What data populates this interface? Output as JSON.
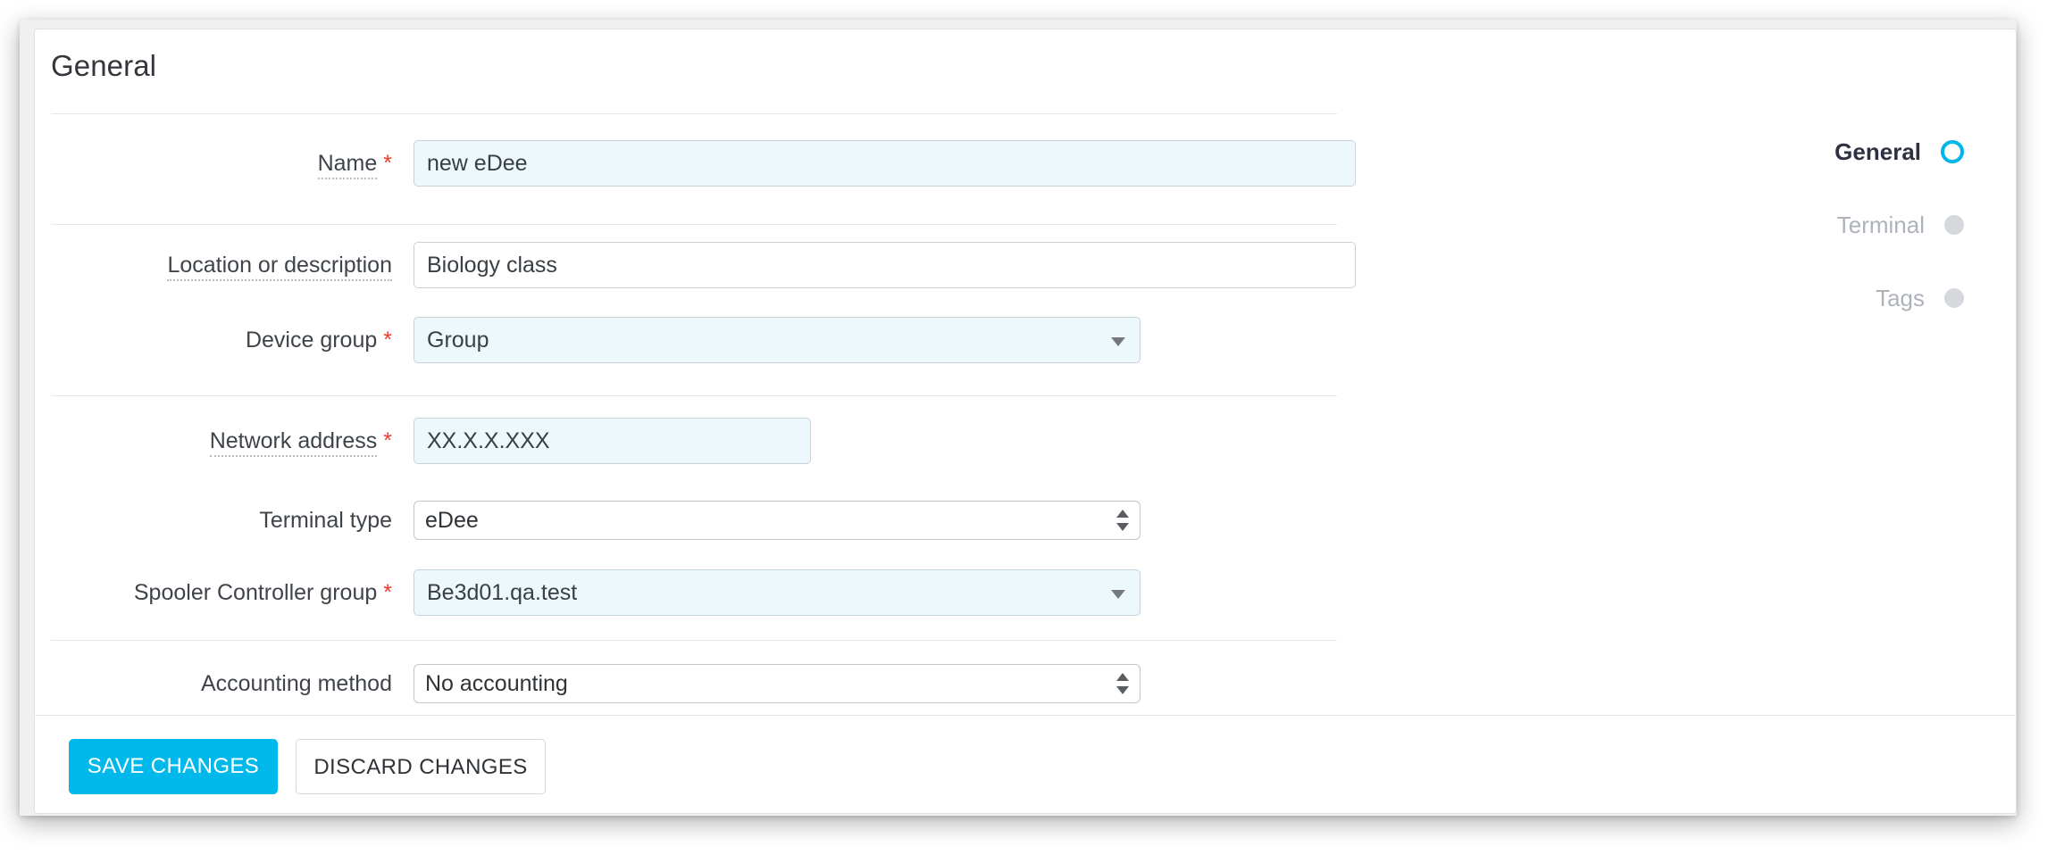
{
  "card": {
    "title": "General"
  },
  "form": {
    "rows": [
      {
        "id": "name",
        "label": "Name",
        "required": true,
        "tooltip_underline": true,
        "control": "text",
        "value": "new eDee",
        "highlight": true
      },
      {
        "id": "location",
        "label": "Location or description",
        "required": false,
        "tooltip_underline": true,
        "control": "text",
        "value": "Biology class",
        "highlight": false
      },
      {
        "id": "device-group",
        "label": "Device group",
        "required": true,
        "tooltip_underline": false,
        "control": "dropdown",
        "value": "Group",
        "highlight": true
      },
      {
        "id": "network-address",
        "label": "Network address",
        "required": true,
        "tooltip_underline": true,
        "control": "text",
        "value": "XX.X.X.XXX",
        "highlight": true
      },
      {
        "id": "terminal-type",
        "label": "Terminal type",
        "required": false,
        "tooltip_underline": false,
        "control": "select",
        "value": "eDee",
        "highlight": false
      },
      {
        "id": "spooler-controller-group",
        "label": "Spooler Controller group",
        "required": true,
        "tooltip_underline": false,
        "control": "dropdown",
        "value": "Be3d01.qa.test",
        "highlight": true
      },
      {
        "id": "accounting-method",
        "label": "Accounting method",
        "required": false,
        "tooltip_underline": false,
        "control": "select",
        "value": "No accounting",
        "highlight": false
      }
    ],
    "required_marker": "*"
  },
  "nav": {
    "items": [
      {
        "label": "General",
        "active": true,
        "indicator": "ring-icon"
      },
      {
        "label": "Terminal",
        "active": false,
        "indicator": "dot-icon"
      },
      {
        "label": "Tags",
        "active": false,
        "indicator": "dot-icon"
      }
    ]
  },
  "footer": {
    "save_label": "SAVE CHANGES",
    "discard_label": "DISCARD CHANGES"
  },
  "colors": {
    "accent": "#00b8ea",
    "required": "#ef3b2d",
    "field_highlight": "#edf8fd",
    "page_bg": "#f0f0f0",
    "nav_inactive": "#aeb2bb",
    "nav_dot": "#d5d8dc"
  }
}
